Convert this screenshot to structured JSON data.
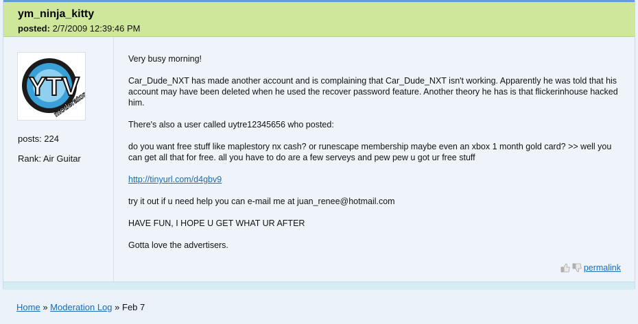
{
  "post": {
    "username": "ym_ninja_kitty",
    "posted_label": "posted:",
    "posted_date": "2/7/2009 12:39:46 PM",
    "avatar_text": "YTV",
    "avatar_subtext": "moderator",
    "posts_label": "posts: 224",
    "rank_label": "Rank: Air Guitar",
    "paragraphs": {
      "p1": "Very busy morning!",
      "p2": "Car_Dude_NXT has made another account and is complaining that Car_Dude_NXT isn't working. Apparently he was told that his account may have been deleted when he used the recover password feature. Another theory he has is that flickerinhouse hacked him.",
      "p3": "There's also a user called uytre12345656 who posted:",
      "p4": "do you want free stuff like maplestory nx cash? or runescape membership maybe even an xbox 1 month gold card? >> well you can get all that for free. all you have to do are a few serveys and pew pew u got ur free stuff",
      "link": "http://tinyurl.com/d4gbv9",
      "p6": "try it out if u need help you can e-mail me at juan_renee@hotmail.com",
      "p7": "HAVE FUN, I HOPE U GET WHAT UR AFTER",
      "p8": "Gotta love the advertisers."
    },
    "permalink": "permalink"
  },
  "breadcrumb": {
    "home": "Home",
    "sep1": "»",
    "moderation_log": "Moderation Log",
    "sep2": "»",
    "current": "Feb 7"
  },
  "colors": {
    "header_bg": "#cfe79b",
    "header_border": "#5b9fd3",
    "link": "#1a6ab8",
    "page_bg": "#eaf1f8"
  }
}
